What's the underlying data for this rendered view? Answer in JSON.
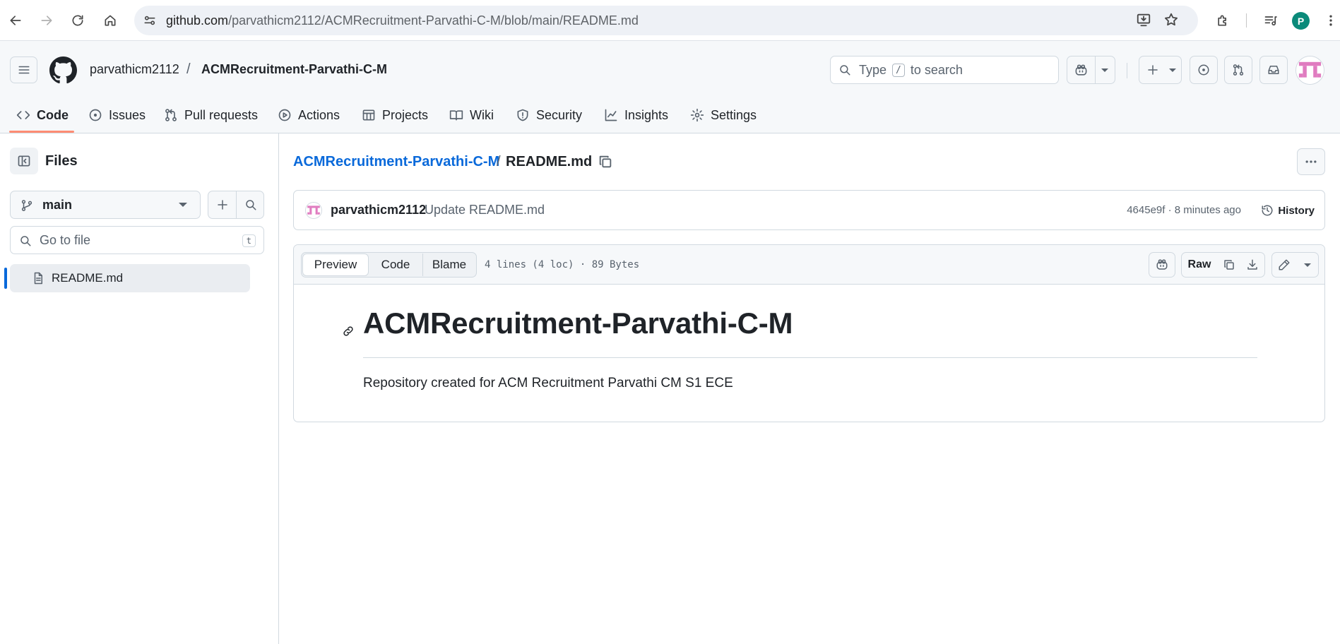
{
  "browser": {
    "url_host": "github.com",
    "url_path": "/parvathicm2112/ACMRecruitment-Parvathi-C-M/blob/main/README.md",
    "profile_initial": "P",
    "profile_color": "#0b8a7a"
  },
  "header": {
    "owner": "parvathicm2112",
    "path_separator": "/",
    "repo": "ACMRecruitment-Parvathi-C-M",
    "search_prefix": "Type",
    "search_key": "/",
    "search_suffix": "to search"
  },
  "repo_nav": {
    "tabs": [
      {
        "label": "Code",
        "icon": "code-icon",
        "active": true
      },
      {
        "label": "Issues",
        "icon": "issue-icon"
      },
      {
        "label": "Pull requests",
        "icon": "pull-request-icon"
      },
      {
        "label": "Actions",
        "icon": "play-icon"
      },
      {
        "label": "Projects",
        "icon": "table-icon"
      },
      {
        "label": "Wiki",
        "icon": "book-icon"
      },
      {
        "label": "Security",
        "icon": "shield-icon"
      },
      {
        "label": "Insights",
        "icon": "graph-icon"
      },
      {
        "label": "Settings",
        "icon": "gear-icon"
      }
    ],
    "accent_color": "#fd8c73"
  },
  "sidebar": {
    "title": "Files",
    "branch": "main",
    "goto_placeholder": "Go to file",
    "goto_shortcut": "t",
    "files": [
      {
        "name": "README.md",
        "selected": true
      }
    ]
  },
  "breadcrumb": {
    "repo": "ACMRecruitment-Parvathi-C-M",
    "separator": "/",
    "file": "README.md"
  },
  "commit": {
    "author": "parvathicm2112",
    "message": "Update README.md",
    "meta": "4645e9f · 8 minutes ago",
    "history_label": "History"
  },
  "file_view": {
    "tabs": [
      "Preview",
      "Code",
      "Blame"
    ],
    "selected_tab": "Preview",
    "info": "4 lines (4 loc) · 89 Bytes",
    "raw_label": "Raw"
  },
  "readme": {
    "heading": "ACMRecruitment-Parvathi-C-M",
    "body": "Repository created for ACM Recruitment Parvathi CM S1 ECE"
  },
  "colors": {
    "link": "#0969da",
    "border": "#d1d9e0",
    "text": "#1f2328",
    "muted": "#59636e"
  }
}
